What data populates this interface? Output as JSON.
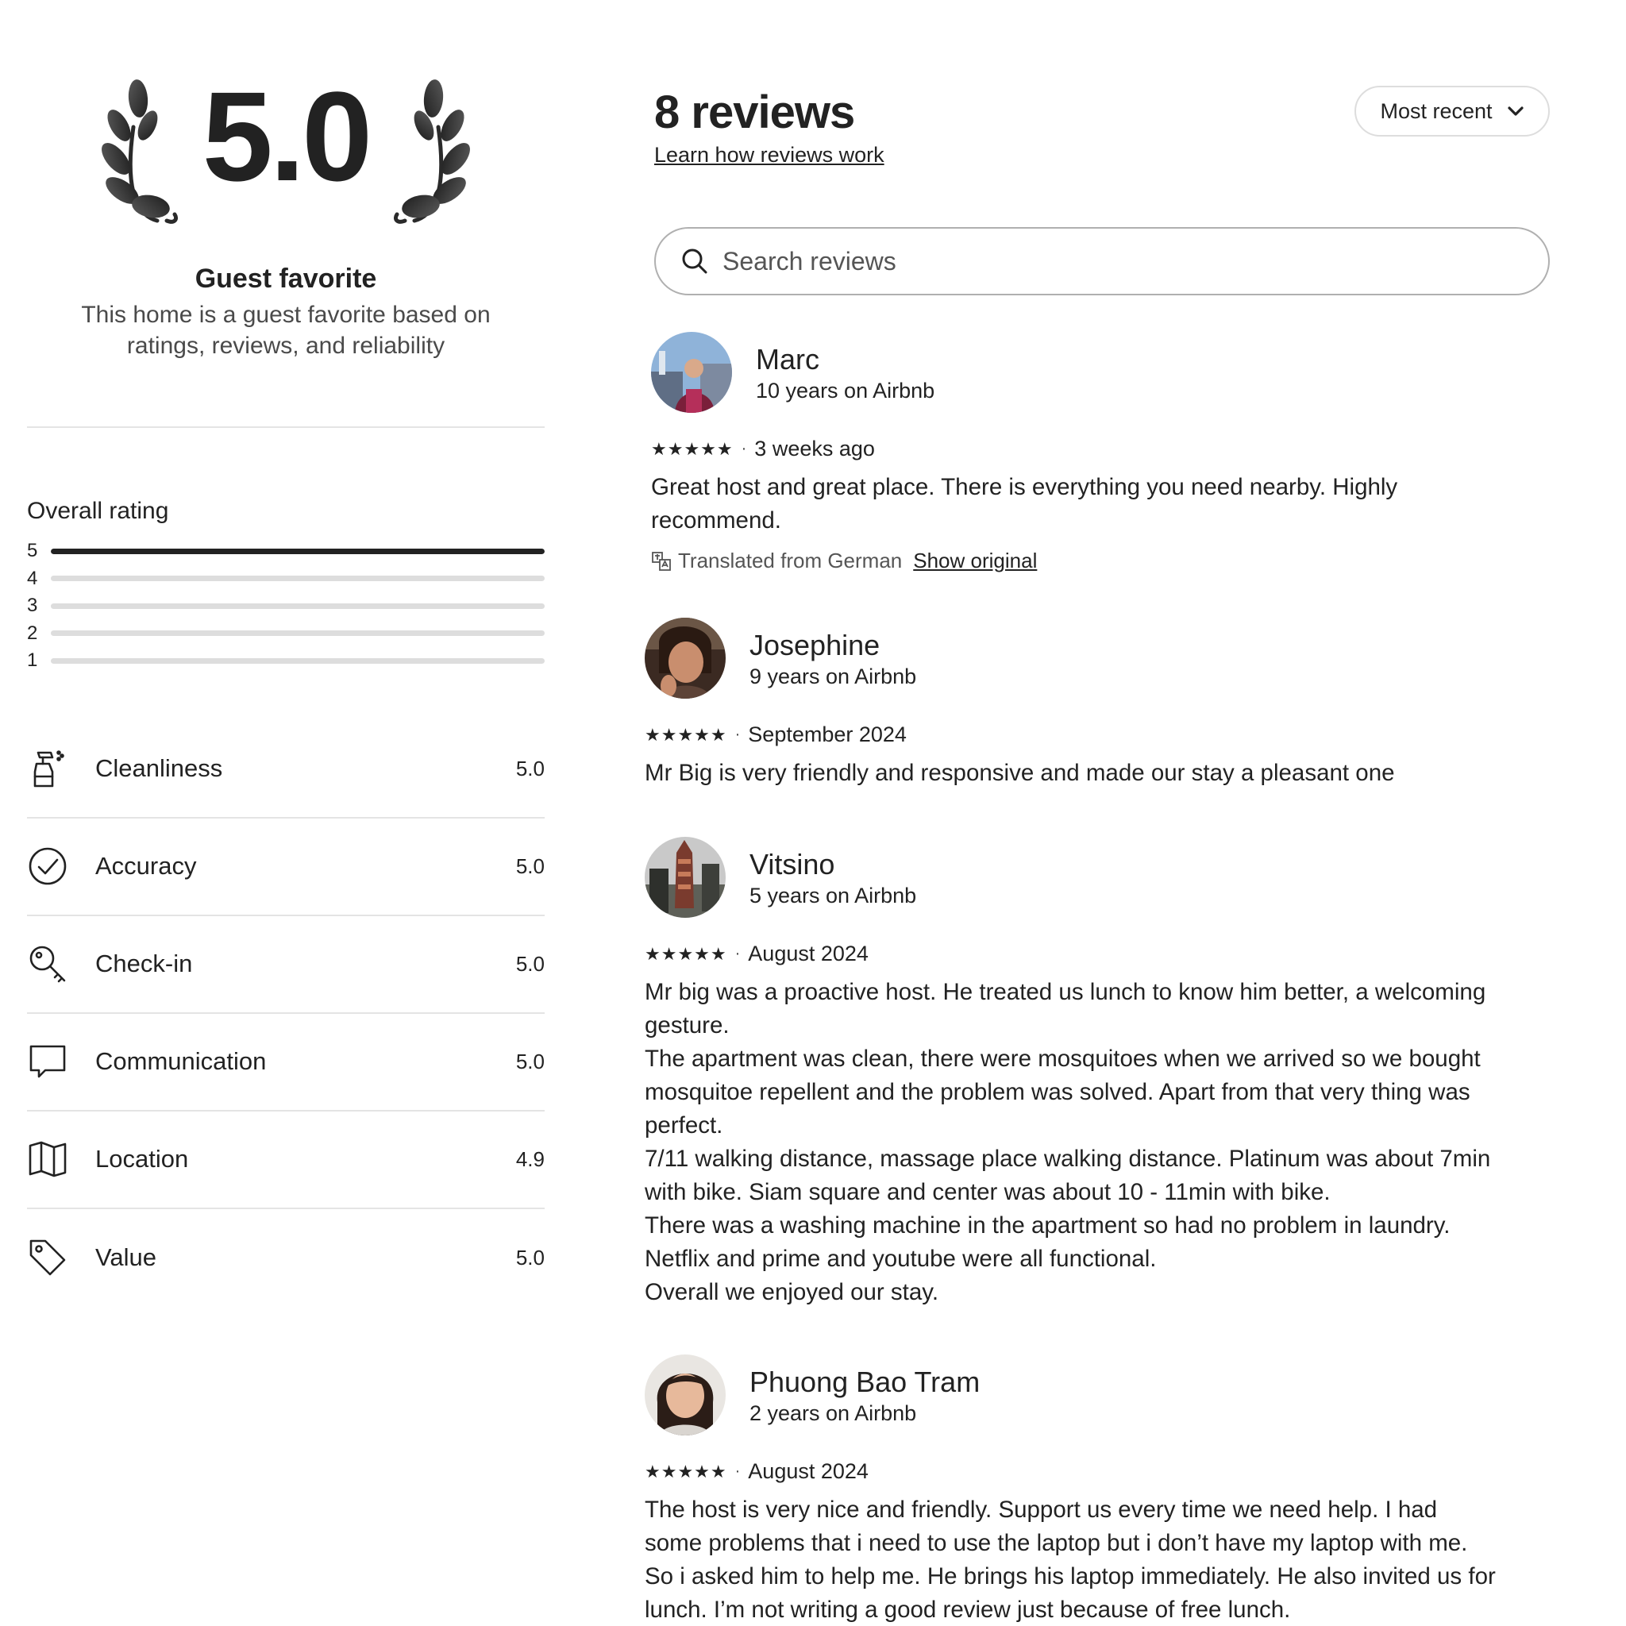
{
  "summary": {
    "score": "5.0",
    "title": "Guest favorite",
    "subtitle_line1": "This home is a guest favorite based on",
    "subtitle_line2": "ratings, reviews, and reliability"
  },
  "overall_rating": {
    "label": "Overall rating",
    "bars": [
      {
        "stars": "5",
        "fraction": 1.0
      },
      {
        "stars": "4",
        "fraction": 0.0
      },
      {
        "stars": "3",
        "fraction": 0.0
      },
      {
        "stars": "2",
        "fraction": 0.0
      },
      {
        "stars": "1",
        "fraction": 0.0
      }
    ]
  },
  "categories": [
    {
      "label": "Cleanliness",
      "value": "5.0",
      "icon": "spray-bottle-icon"
    },
    {
      "label": "Accuracy",
      "value": "5.0",
      "icon": "check-circle-icon"
    },
    {
      "label": "Check-in",
      "value": "5.0",
      "icon": "key-icon"
    },
    {
      "label": "Communication",
      "value": "5.0",
      "icon": "chat-bubble-icon"
    },
    {
      "label": "Location",
      "value": "4.9",
      "icon": "map-icon"
    },
    {
      "label": "Value",
      "value": "5.0",
      "icon": "price-tag-icon"
    }
  ],
  "header": {
    "title": "8 reviews",
    "learn_link": "Learn how reviews work",
    "sort_label": "Most recent"
  },
  "search": {
    "placeholder": "Search reviews"
  },
  "reviews": [
    {
      "name": "Marc",
      "tenure": "10 years on Airbnb",
      "stars": "★★★★★",
      "date": "3 weeks ago",
      "text": "Great host and great place. There is everything you need nearby. Highly\nrecommend.",
      "translated_note": "Translated from German",
      "show_original": "Show original"
    },
    {
      "name": "Josephine",
      "tenure": "9 years on Airbnb",
      "stars": "★★★★★",
      "date": "September 2024",
      "text": "Mr Big is very friendly and responsive and made our stay a pleasant one"
    },
    {
      "name": "Vitsino",
      "tenure": "5 years on Airbnb",
      "stars": "★★★★★",
      "date": "August 2024",
      "text": "Mr big was a proactive host. He treated us lunch to know him better, a welcoming\ngesture.\nThe apartment was clean, there were mosquitoes when we arrived so we bought\nmosquitoe repellent and the problem was solved. Apart from that very thing was\nperfect.\n7/11 walking distance, massage place walking distance. Platinum was about 7min\nwith bike. Siam square and center was about 10 - 11min with bike.\nThere was a washing machine in the apartment so had no problem in laundry.\nNetflix and prime and youtube were all functional.\nOverall we enjoyed our stay."
    },
    {
      "name": "Phuong Bao Tram",
      "tenure": "2 years on Airbnb",
      "stars": "★★★★★",
      "date": "August 2024",
      "text": "The host is very nice and friendly. Support us every time we need help. I had\nsome problems that i need to use the laptop but i don’t have my laptop with me.\nSo i asked him to help me. He brings his laptop immediately. He also invited us for\nlunch. I’m not writing a good review just because of free lunch."
    }
  ]
}
